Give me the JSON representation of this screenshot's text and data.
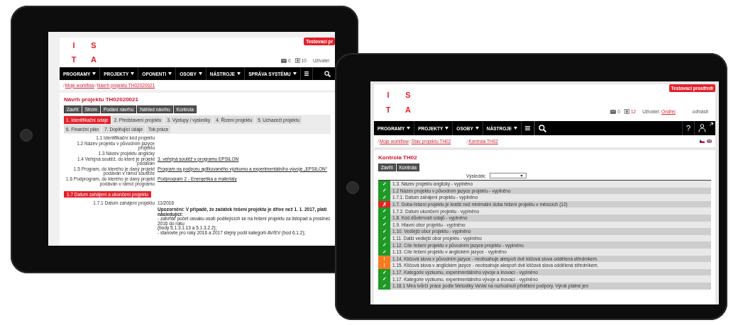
{
  "back_tablet": {
    "screen": {
      "environment_badge": "Testovací pr",
      "logo": [
        "I",
        "S",
        "T",
        "A"
      ],
      "header": {
        "messages_count": "0",
        "tasks_count": "10",
        "user_label": "Uživatel"
      },
      "nav": [
        {
          "label": "PROGRAMY",
          "dropdown": true
        },
        {
          "label": "PROJEKTY",
          "dropdown": true
        },
        {
          "label": "OPONENTI",
          "dropdown": true
        },
        {
          "label": "OSOBY",
          "dropdown": true
        },
        {
          "label": "NÁSTROJE",
          "dropdown": true
        },
        {
          "label": "SPRÁVA SYSTÉMU",
          "dropdown": true
        }
      ],
      "breadcrumb": [
        {
          "separator": "/",
          "label": "Moje workflow"
        },
        {
          "separator": "/",
          "label": "Návrh projektu TH02020021"
        }
      ],
      "title": "Návrh projektu TH02020021",
      "buttons": [
        "Zavřít",
        "Strom",
        "Podání návrhu",
        "Náhled návrhu",
        "Kontrola"
      ],
      "tabs": [
        {
          "label": "1. Identifikační údaje",
          "selected": true
        },
        {
          "label": "2. Představení projektu",
          "selected": false
        },
        {
          "label": "3. Výstupy / výsledky",
          "selected": false
        },
        {
          "label": "4. Řízení projektu",
          "selected": false
        },
        {
          "label": "5. Uchazeči projektu",
          "selected": false
        },
        {
          "label": "6. Finanční plán",
          "selected": false
        },
        {
          "label": "7. Doplňující údaje",
          "selected": false
        },
        {
          "label": "Tok práce",
          "selected": false
        }
      ],
      "fields": [
        {
          "label": "1.1 Identifikační kód projektu"
        },
        {
          "label": "1.2 Název projektu v původním jazyce projektu"
        },
        {
          "label": "1.3 Název projektu anglicky"
        },
        {
          "label": "1.4 Veřejná soutěž, do které je projekt podáván",
          "value": "3. veřejná soutěž v programu EPSILON"
        },
        {
          "label": "1.5 Program, do kterého je daný projekt podáván v rámci soutěže",
          "value": "Program na podporu aplikovaného výzkumu a experimentálního vývoje „EPSILON“"
        },
        {
          "label": "1.6 Podprogram, do kterého je daný projekt podáván v rámci programu",
          "value": "Podprogram 2 - Energetika a materiály"
        }
      ],
      "section": "1.7 Datum zahájení a ukončení projektu",
      "section_fields": [
        {
          "label": "1.7.1 Datum zahájení projektu",
          "value": "11/2016",
          "notes": [
            "Upozornění: V případě, že začátek řešení projektu je dříve než 1. 1. 2017, platí následující:",
            "- zahrňte počet osvaku osob podílejících se na řešení projektu za listopad a prosinec 2016 do roku",
            "(body 5.1.3.1.13 a 5.1.3.2.2);",
            "- stanovte pro roky 2016 a 2017 stejný podíl kategorií AV/EV (bod 6.1.2);"
          ]
        }
      ]
    }
  },
  "front_tablet": {
    "screen": {
      "environment_badge": "Testovací prostředí",
      "logo": [
        "I",
        "S",
        "T",
        "A"
      ],
      "header": {
        "messages_count": "0",
        "tasks_count": "12",
        "user_label": "Uživatel:",
        "user_name": "Ondřej",
        "logout": "odhlásit"
      },
      "nav": [
        {
          "label": "PROGRAMY",
          "dropdown": true
        },
        {
          "label": "PROJEKTY",
          "dropdown": true
        },
        {
          "label": "OSOBY",
          "dropdown": true
        },
        {
          "label": "NÁSTROJE",
          "dropdown": true
        }
      ],
      "help_label": "?",
      "breadcrumb": [
        {
          "separator": "/",
          "label": "Moje workflow"
        },
        {
          "separator": "/",
          "label": "Stav projektu TH02"
        },
        {
          "separator": "/",
          "label": "Kontrola TH02"
        }
      ],
      "title": "Kontrola TH02",
      "buttons": [
        "Zavřít",
        "Kontrola"
      ],
      "result_filter": {
        "label": "Výsledek:"
      },
      "checks": [
        {
          "kind": "ok",
          "icon": "✓",
          "text": "1.3. Název projektu anglicky - vyplněno"
        },
        {
          "kind": "ok",
          "icon": "✓",
          "text": "1.2 Název projektu v původním jazyce projektu - vyplněno"
        },
        {
          "kind": "ok",
          "icon": "✓",
          "text": "1.7.1. Datum zahájení projektu - vyplněno"
        },
        {
          "kind": "error",
          "icon": "✗",
          "text": "1.7. Doba řešení projektu je kratší než minimální doba řešení projektu v měsících (12)"
        },
        {
          "kind": "ok",
          "icon": "✓",
          "text": "1.7.2. Datum ukončení projektu - vyplněno"
        },
        {
          "kind": "ok",
          "icon": "✓",
          "text": "1.8. Kód důvěrnosti údajů - vyplněno"
        },
        {
          "kind": "ok",
          "icon": "✓",
          "text": "1.9. Hlavní obor projektu - vyplněno"
        },
        {
          "kind": "ok",
          "icon": "✓",
          "text": "1.10. Vedlejší obor projektu - vyplněno"
        },
        {
          "kind": "ok",
          "icon": "✓",
          "text": "1.11. Další vedlejší obor projektu - vyplněno"
        },
        {
          "kind": "ok",
          "icon": "✓",
          "text": "1.12. Cíle řešení projektu v původním jazyce projektu - vyplněno"
        },
        {
          "kind": "ok",
          "icon": "✓",
          "text": "1.13. Cíle řešení projektu v anglickém jazyce - vyplněno"
        },
        {
          "kind": "warning",
          "icon": "!",
          "text": "1.14. Klíčová slova v původním jazyce - neobsahuje alespoň dvě klíčová slova oddělená středníkem."
        },
        {
          "kind": "warning",
          "icon": "!",
          "text": "1.15. Klíčová slova v anglickém jazyce - neobsahuje alespoň dvě klíčová slova oddělená středníkem."
        },
        {
          "kind": "ok",
          "icon": "✓",
          "text": "1.17. Kategorie výzkumu, experimentálního vývoje a inovací - vyplněno"
        },
        {
          "kind": "ok",
          "icon": "✓",
          "text": "1.17. Kategorie výzkumu, experimentálního vývoje a inovací - vyplněno"
        },
        {
          "kind": "ok",
          "icon": "✓",
          "text": "1.18.1 Míra tvůrčí práce podle Metodiky VaVaI na rozhodnutí přidělení podpory. Výrok platné jen"
        }
      ]
    }
  }
}
